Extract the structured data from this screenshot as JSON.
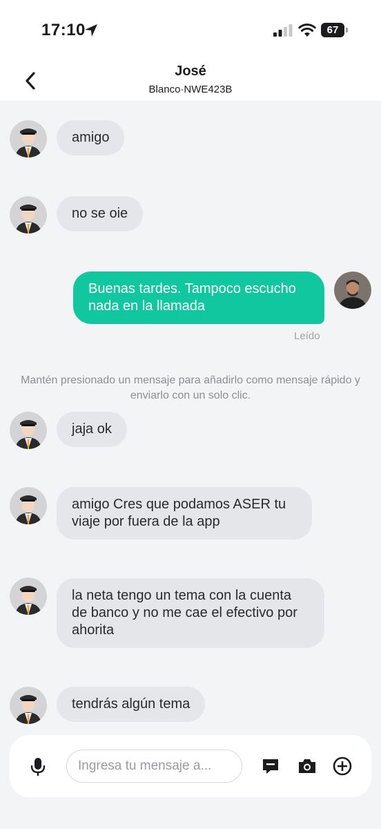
{
  "status": {
    "time": "17:10",
    "battery": "67"
  },
  "header": {
    "name": "José",
    "subtitle": "Blanco·NWE423B"
  },
  "messages": [
    {
      "text": "amigo"
    },
    {
      "text": "no se oie"
    },
    {
      "text": "Buenas tardes. Tampoco escucho nada en la llamada",
      "status": "Leído"
    },
    {
      "text": "jaja ok"
    },
    {
      "text": "amigo Cres que podamos ASER tu viaje por fuera de la app"
    },
    {
      "text": "la neta tengo un tema con la cuenta de banco y no me cae el efectivo por ahorita"
    },
    {
      "text": "tendrás algún tema"
    }
  ],
  "hint": "Mantén presionado un mensaje para añadirlo como mensaje rápido y enviarlo con un solo clic.",
  "composer": {
    "placeholder": "Ingresa tu mensaje a..."
  },
  "colors": {
    "accent": "#10c79f",
    "incoming_bubble": "#e5e6ea",
    "background": "#f3f4f6"
  }
}
